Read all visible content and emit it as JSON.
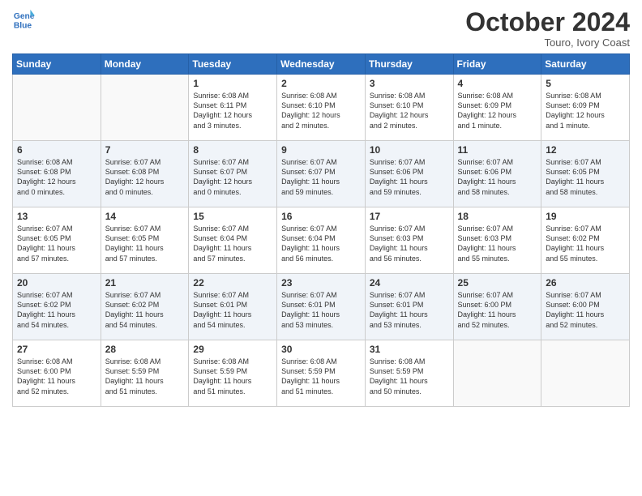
{
  "logo": {
    "line1": "General",
    "line2": "Blue"
  },
  "title": "October 2024",
  "location": "Touro, Ivory Coast",
  "weekdays": [
    "Sunday",
    "Monday",
    "Tuesday",
    "Wednesday",
    "Thursday",
    "Friday",
    "Saturday"
  ],
  "weeks": [
    [
      {
        "day": "",
        "info": ""
      },
      {
        "day": "",
        "info": ""
      },
      {
        "day": "1",
        "info": "Sunrise: 6:08 AM\nSunset: 6:11 PM\nDaylight: 12 hours\nand 3 minutes."
      },
      {
        "day": "2",
        "info": "Sunrise: 6:08 AM\nSunset: 6:10 PM\nDaylight: 12 hours\nand 2 minutes."
      },
      {
        "day": "3",
        "info": "Sunrise: 6:08 AM\nSunset: 6:10 PM\nDaylight: 12 hours\nand 2 minutes."
      },
      {
        "day": "4",
        "info": "Sunrise: 6:08 AM\nSunset: 6:09 PM\nDaylight: 12 hours\nand 1 minute."
      },
      {
        "day": "5",
        "info": "Sunrise: 6:08 AM\nSunset: 6:09 PM\nDaylight: 12 hours\nand 1 minute."
      }
    ],
    [
      {
        "day": "6",
        "info": "Sunrise: 6:08 AM\nSunset: 6:08 PM\nDaylight: 12 hours\nand 0 minutes."
      },
      {
        "day": "7",
        "info": "Sunrise: 6:07 AM\nSunset: 6:08 PM\nDaylight: 12 hours\nand 0 minutes."
      },
      {
        "day": "8",
        "info": "Sunrise: 6:07 AM\nSunset: 6:07 PM\nDaylight: 12 hours\nand 0 minutes."
      },
      {
        "day": "9",
        "info": "Sunrise: 6:07 AM\nSunset: 6:07 PM\nDaylight: 11 hours\nand 59 minutes."
      },
      {
        "day": "10",
        "info": "Sunrise: 6:07 AM\nSunset: 6:06 PM\nDaylight: 11 hours\nand 59 minutes."
      },
      {
        "day": "11",
        "info": "Sunrise: 6:07 AM\nSunset: 6:06 PM\nDaylight: 11 hours\nand 58 minutes."
      },
      {
        "day": "12",
        "info": "Sunrise: 6:07 AM\nSunset: 6:05 PM\nDaylight: 11 hours\nand 58 minutes."
      }
    ],
    [
      {
        "day": "13",
        "info": "Sunrise: 6:07 AM\nSunset: 6:05 PM\nDaylight: 11 hours\nand 57 minutes."
      },
      {
        "day": "14",
        "info": "Sunrise: 6:07 AM\nSunset: 6:05 PM\nDaylight: 11 hours\nand 57 minutes."
      },
      {
        "day": "15",
        "info": "Sunrise: 6:07 AM\nSunset: 6:04 PM\nDaylight: 11 hours\nand 57 minutes."
      },
      {
        "day": "16",
        "info": "Sunrise: 6:07 AM\nSunset: 6:04 PM\nDaylight: 11 hours\nand 56 minutes."
      },
      {
        "day": "17",
        "info": "Sunrise: 6:07 AM\nSunset: 6:03 PM\nDaylight: 11 hours\nand 56 minutes."
      },
      {
        "day": "18",
        "info": "Sunrise: 6:07 AM\nSunset: 6:03 PM\nDaylight: 11 hours\nand 55 minutes."
      },
      {
        "day": "19",
        "info": "Sunrise: 6:07 AM\nSunset: 6:02 PM\nDaylight: 11 hours\nand 55 minutes."
      }
    ],
    [
      {
        "day": "20",
        "info": "Sunrise: 6:07 AM\nSunset: 6:02 PM\nDaylight: 11 hours\nand 54 minutes."
      },
      {
        "day": "21",
        "info": "Sunrise: 6:07 AM\nSunset: 6:02 PM\nDaylight: 11 hours\nand 54 minutes."
      },
      {
        "day": "22",
        "info": "Sunrise: 6:07 AM\nSunset: 6:01 PM\nDaylight: 11 hours\nand 54 minutes."
      },
      {
        "day": "23",
        "info": "Sunrise: 6:07 AM\nSunset: 6:01 PM\nDaylight: 11 hours\nand 53 minutes."
      },
      {
        "day": "24",
        "info": "Sunrise: 6:07 AM\nSunset: 6:01 PM\nDaylight: 11 hours\nand 53 minutes."
      },
      {
        "day": "25",
        "info": "Sunrise: 6:07 AM\nSunset: 6:00 PM\nDaylight: 11 hours\nand 52 minutes."
      },
      {
        "day": "26",
        "info": "Sunrise: 6:07 AM\nSunset: 6:00 PM\nDaylight: 11 hours\nand 52 minutes."
      }
    ],
    [
      {
        "day": "27",
        "info": "Sunrise: 6:08 AM\nSunset: 6:00 PM\nDaylight: 11 hours\nand 52 minutes."
      },
      {
        "day": "28",
        "info": "Sunrise: 6:08 AM\nSunset: 5:59 PM\nDaylight: 11 hours\nand 51 minutes."
      },
      {
        "day": "29",
        "info": "Sunrise: 6:08 AM\nSunset: 5:59 PM\nDaylight: 11 hours\nand 51 minutes."
      },
      {
        "day": "30",
        "info": "Sunrise: 6:08 AM\nSunset: 5:59 PM\nDaylight: 11 hours\nand 51 minutes."
      },
      {
        "day": "31",
        "info": "Sunrise: 6:08 AM\nSunset: 5:59 PM\nDaylight: 11 hours\nand 50 minutes."
      },
      {
        "day": "",
        "info": ""
      },
      {
        "day": "",
        "info": ""
      }
    ]
  ]
}
